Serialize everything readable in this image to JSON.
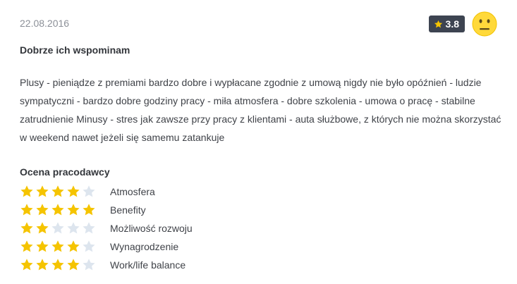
{
  "review": {
    "date": "22.08.2016",
    "score": "3.8",
    "title": "Dobrze ich wspominam",
    "body": "Plusy - pieniądze z premiami bardzo dobre i wypłacane zgodnie z umową nigdy nie było opóźnień - ludzie sympatyczni - bardzo dobre godziny pracy - miła atmosfera - dobre szkolenia - umowa o pracę - stabilne zatrudnienie Minusy - stres jak zawsze przy pracy z klientami - auta służbowe, z których nie można skorzystać w weekend nawet jeżeli się samemu zatankuje",
    "ratings_heading": "Ocena pracodawcy",
    "ratings": [
      {
        "label": "Atmosfera",
        "stars": 4,
        "max": 5
      },
      {
        "label": "Benefity",
        "stars": 5,
        "max": 5
      },
      {
        "label": "Możliwość rozwoju",
        "stars": 2,
        "max": 5
      },
      {
        "label": "Wynagrodzenie",
        "stars": 4,
        "max": 5
      },
      {
        "label": "Work/life balance",
        "stars": 4,
        "max": 5
      }
    ],
    "icons": {
      "score": "star-icon",
      "mood": "neutral-face-icon",
      "rating_star": "star-icon"
    }
  },
  "colors": {
    "star_filled": "#f5c400",
    "star_empty": "#dde5ee",
    "badge_bg": "#3d4451",
    "face": "#ffd93b"
  }
}
